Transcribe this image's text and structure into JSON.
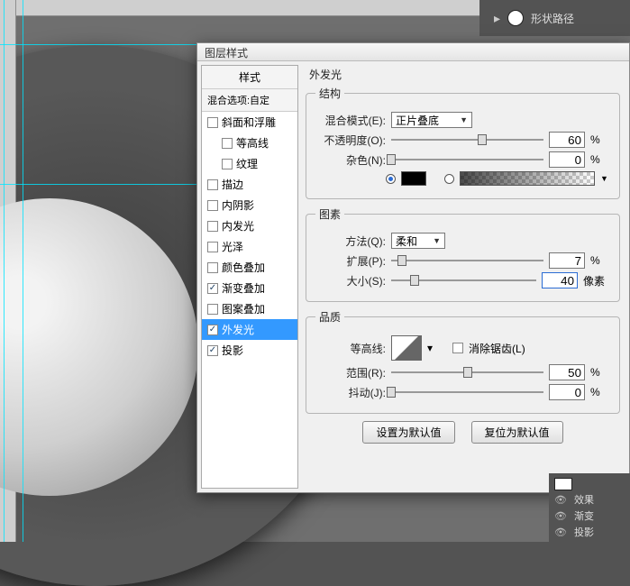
{
  "topbar": {
    "shape_path_label": "形状路径"
  },
  "dialog": {
    "title": "图层样式",
    "styles_header": "样式",
    "blend_header": "混合选项:自定",
    "items": [
      {
        "label": "斜面和浮雕",
        "checked": false
      },
      {
        "label": "等高线",
        "checked": false,
        "indent": true
      },
      {
        "label": "纹理",
        "checked": false,
        "indent": true
      },
      {
        "label": "描边",
        "checked": false
      },
      {
        "label": "内阴影",
        "checked": false
      },
      {
        "label": "内发光",
        "checked": false
      },
      {
        "label": "光泽",
        "checked": false
      },
      {
        "label": "颜色叠加",
        "checked": false
      },
      {
        "label": "渐变叠加",
        "checked": true
      },
      {
        "label": "图案叠加",
        "checked": false
      },
      {
        "label": "外发光",
        "checked": true,
        "selected": true
      },
      {
        "label": "投影",
        "checked": true
      }
    ],
    "panel_title": "外发光",
    "structure": {
      "legend": "结构",
      "blend_mode_label": "混合模式(E):",
      "blend_mode_value": "正片叠底",
      "opacity_label": "不透明度(O):",
      "opacity_value": "60",
      "opacity_unit": "%",
      "noise_label": "杂色(N):",
      "noise_value": "0",
      "noise_unit": "%"
    },
    "elements": {
      "legend": "图素",
      "technique_label": "方法(Q):",
      "technique_value": "柔和",
      "spread_label": "扩展(P):",
      "spread_value": "7",
      "spread_unit": "%",
      "size_label": "大小(S):",
      "size_value": "40",
      "size_unit": "像素"
    },
    "quality": {
      "legend": "品质",
      "contour_label": "等高线:",
      "antialias_label": "消除锯齿(L)",
      "range_label": "范围(R):",
      "range_value": "50",
      "range_unit": "%",
      "jitter_label": "抖动(J):",
      "jitter_value": "0",
      "jitter_unit": "%"
    },
    "buttons": {
      "default": "设置为默认值",
      "reset": "复位为默认值"
    }
  },
  "layers": {
    "fx": "效果",
    "grad": "渐变",
    "shadow": "投影"
  }
}
